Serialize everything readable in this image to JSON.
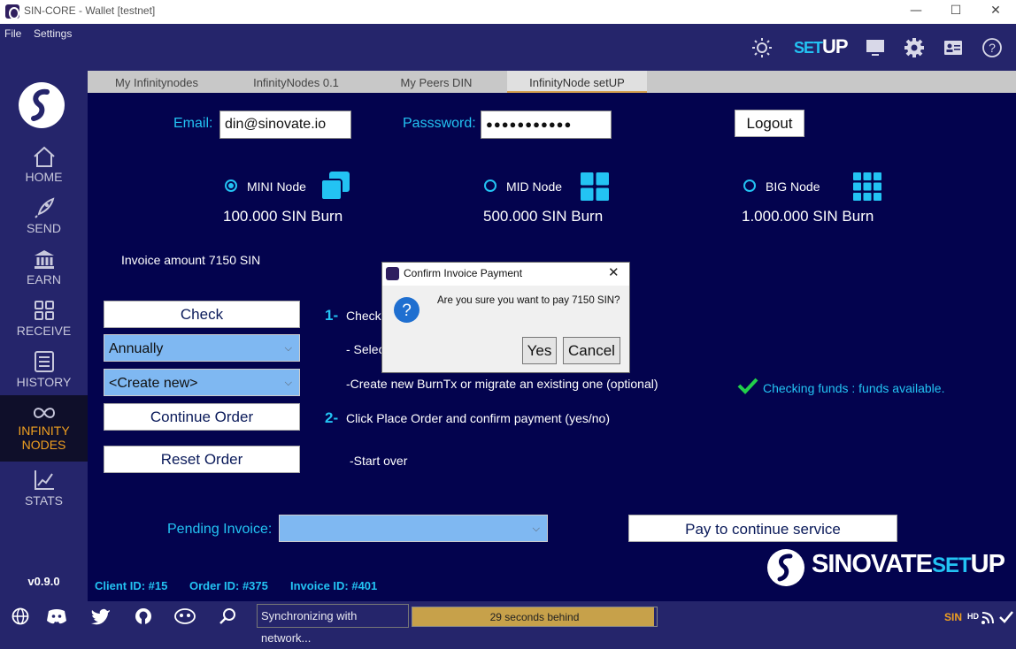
{
  "window": {
    "title": "SIN-CORE - Wallet [testnet]",
    "minimize": "—",
    "maximize": "☐",
    "close": "✕"
  },
  "menu": {
    "file": "File",
    "settings": "Settings"
  },
  "toolbar": {
    "setup_prefix": "SET",
    "setup_suffix": "UP"
  },
  "sidebar": {
    "items": [
      {
        "label": "HOME"
      },
      {
        "label": "SEND"
      },
      {
        "label": "EARN"
      },
      {
        "label": "RECEIVE"
      },
      {
        "label": "HISTORY"
      },
      {
        "label_line1": "INFINITY",
        "label_line2": "NODES"
      },
      {
        "label": "STATS"
      }
    ],
    "version": "v0.9.0"
  },
  "tabs": [
    {
      "label": "My Infinitynodes"
    },
    {
      "label": "InfinityNodes 0.1"
    },
    {
      "label": "My Peers DIN"
    },
    {
      "label": "InfinityNode setUP"
    }
  ],
  "login": {
    "email_label": "Email:",
    "email_value": "din@sinovate.io",
    "password_label": "Passsword:",
    "password_value": "●●●●●●●●●●●",
    "logout": "Logout"
  },
  "nodes": [
    {
      "label": "MINI Node",
      "burn": "100.000 SIN Burn",
      "selected": true
    },
    {
      "label": "MID Node",
      "burn": "500.000 SIN Burn",
      "selected": false
    },
    {
      "label": "BIG Node",
      "burn": "1.000.000 SIN Burn",
      "selected": false
    }
  ],
  "invoice_amount": "Invoice amount 7150 SIN",
  "actions": {
    "check": "Check",
    "period_value": "Annually",
    "burn_value": "<Create new>",
    "continue": "Continue Order",
    "reset": "Reset Order"
  },
  "steps": {
    "s1_num": "1-",
    "s1_text": "Check",
    "s1_sub": "- Selec",
    "s1_sub2": "-Create new BurnTx or migrate an existing one (optional)",
    "s2_num": "2-",
    "s2_text": "Click Place Order and confirm payment (yes/no)",
    "s3_text": "-Start over"
  },
  "funds_status": "Checking funds : funds available.",
  "pending_invoice_label": "Pending Invoice:",
  "pay_button": "Pay to continue service",
  "brand": {
    "part1": "SINOVATE",
    "part2": "SET",
    "part3": "UP"
  },
  "ids": {
    "client": "Client ID: #15",
    "order": "Order ID: #375",
    "invoice": "Invoice ID: #401"
  },
  "dialog": {
    "title": "Confirm Invoice Payment",
    "message": "Are you sure you want to pay 7150 SIN?",
    "yes": "Yes",
    "cancel": "Cancel",
    "close": "✕"
  },
  "statusbar": {
    "sync_text": "Synchronizing with network...",
    "behind": "29 seconds behind",
    "progress_fraction": 0.99,
    "unit": "SIN",
    "hd": "HD"
  }
}
